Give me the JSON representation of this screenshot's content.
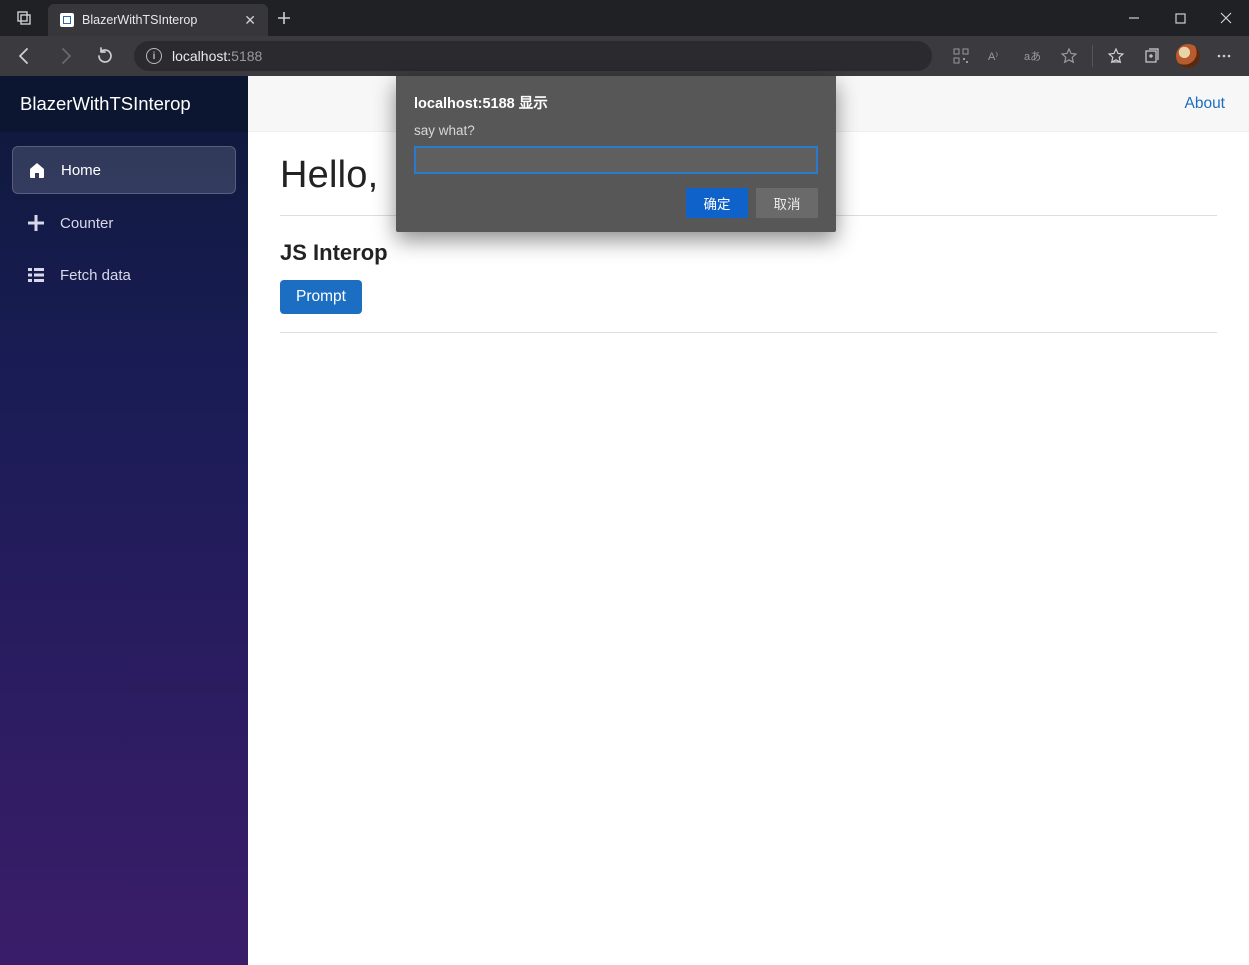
{
  "browser": {
    "tab_title": "BlazerWithTSInterop",
    "url_host": "localhost:",
    "url_port": "5188"
  },
  "sidebar": {
    "brand": "BlazerWithTSInterop",
    "items": [
      {
        "label": "Home"
      },
      {
        "label": "Counter"
      },
      {
        "label": "Fetch data"
      }
    ]
  },
  "topbar": {
    "about": "About"
  },
  "page": {
    "heading": "Hello,",
    "section_title": "JS Interop",
    "prompt_button": "Prompt"
  },
  "dialog": {
    "title": "localhost:5188 显示",
    "message": "say what?",
    "input_value": "",
    "ok": "确定",
    "cancel": "取消"
  }
}
